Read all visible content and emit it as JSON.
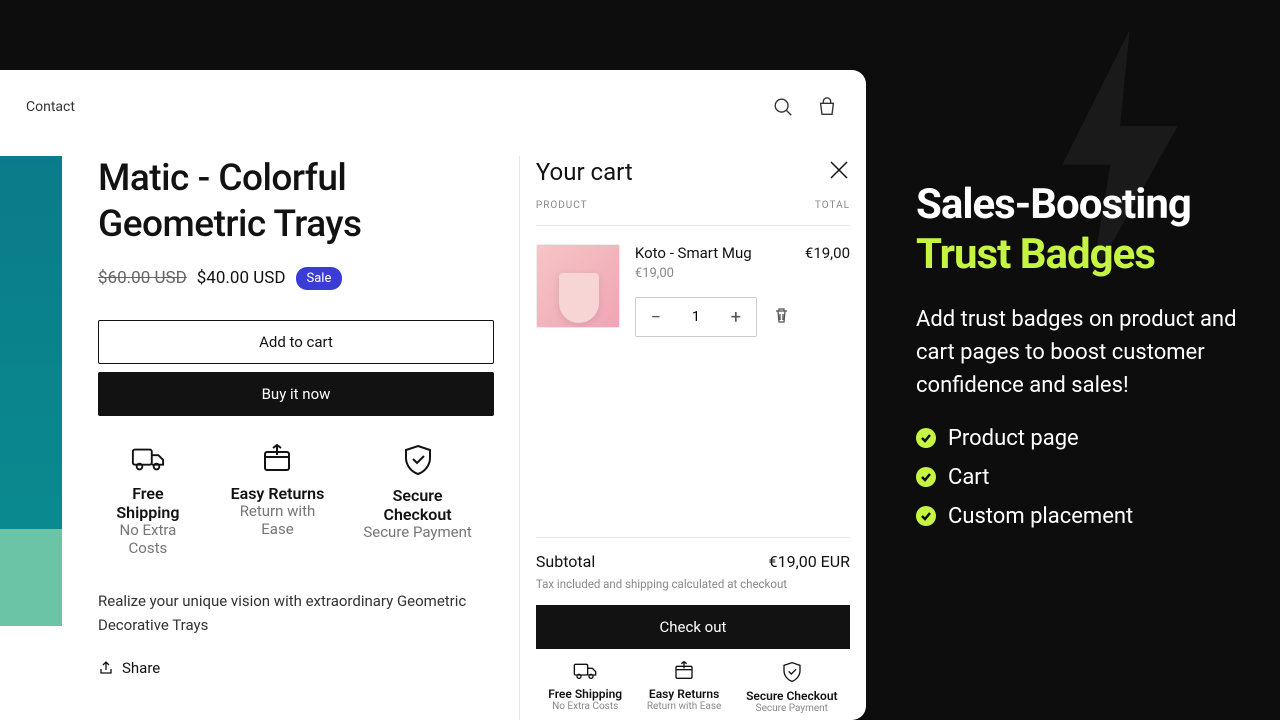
{
  "nav": {
    "contact": "Contact"
  },
  "product": {
    "title": "Matic - Colorful Geometric Trays",
    "price_old": "$60.00 USD",
    "price_new": "$40.00 USD",
    "sale_label": "Sale",
    "add_to_cart": "Add to cart",
    "buy_now": "Buy it now",
    "description": "Realize your unique vision with extraordinary Geometric Decorative Trays",
    "share": "Share"
  },
  "badges": [
    {
      "title": "Free Shipping",
      "sub": "No Extra Costs"
    },
    {
      "title": "Easy Returns",
      "sub": "Return with Ease"
    },
    {
      "title": "Secure Checkout",
      "sub": "Secure Payment"
    }
  ],
  "cart": {
    "title": "Your cart",
    "col_product": "PRODUCT",
    "col_total": "TOTAL",
    "item": {
      "name": "Koto - Smart Mug",
      "unit_price": "€19,00",
      "total": "€19,00",
      "qty": "1"
    },
    "subtotal_label": "Subtotal",
    "subtotal_value": "€19,00 EUR",
    "tax_note": "Tax included and shipping calculated at checkout",
    "checkout": "Check out"
  },
  "marketing": {
    "title_line1": "Sales-Boosting",
    "title_line2": "Trust Badges",
    "desc": "Add trust badges on product and cart pages to boost customer confidence and sales!",
    "bullets": [
      "Product page",
      "Cart",
      "Custom placement"
    ]
  }
}
